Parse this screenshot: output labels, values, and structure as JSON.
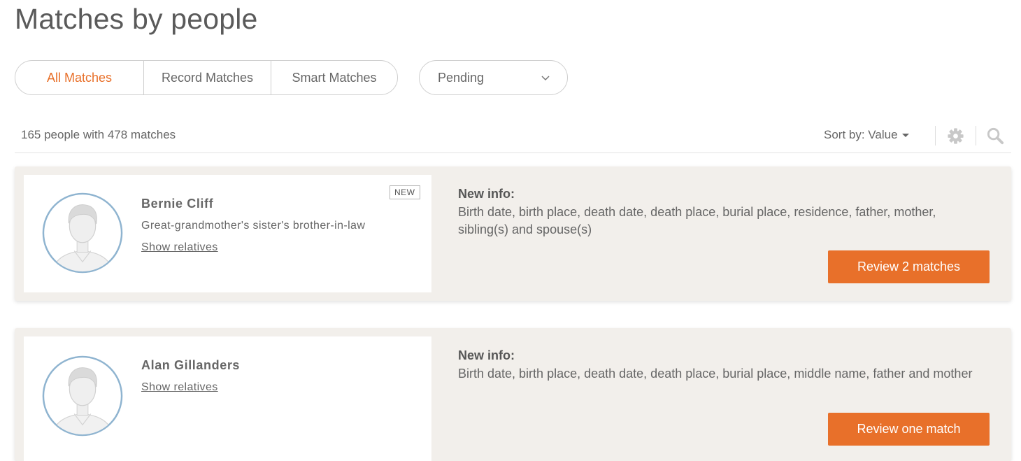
{
  "page": {
    "title": "Matches by people"
  },
  "filters": {
    "tabs": [
      {
        "label": "All Matches",
        "active": true
      },
      {
        "label": "Record Matches",
        "active": false
      },
      {
        "label": "Smart Matches",
        "active": false
      }
    ],
    "status_dropdown": {
      "value": "Pending",
      "icon": "chevron-down-icon"
    }
  },
  "summary": {
    "text": "165 people with 478 matches"
  },
  "sort": {
    "label": "Sort by: Value"
  },
  "toolbar": {
    "settings_icon": "gear-icon",
    "search_icon": "search-icon"
  },
  "colors": {
    "accent": "#e8702a",
    "card_bg": "#f2efeb",
    "avatar_ring": "#8fb4d0"
  },
  "people": [
    {
      "name": "Bernie Cliff",
      "relation": "Great-grandmother's sister's brother-in-law",
      "show_relatives": "Show relatives",
      "badge": "NEW",
      "info_title": "New info:",
      "info_text": "Birth date, birth place, death date, death place, burial place, residence, father, mother, sibling(s) and spouse(s)",
      "button": "Review 2 matches"
    },
    {
      "name": "Alan Gillanders",
      "relation": "",
      "show_relatives": "Show relatives",
      "badge": "",
      "info_title": "New info:",
      "info_text": "Birth date, birth place, death date, death place, burial place, middle name, father and mother",
      "button": "Review one match"
    }
  ]
}
